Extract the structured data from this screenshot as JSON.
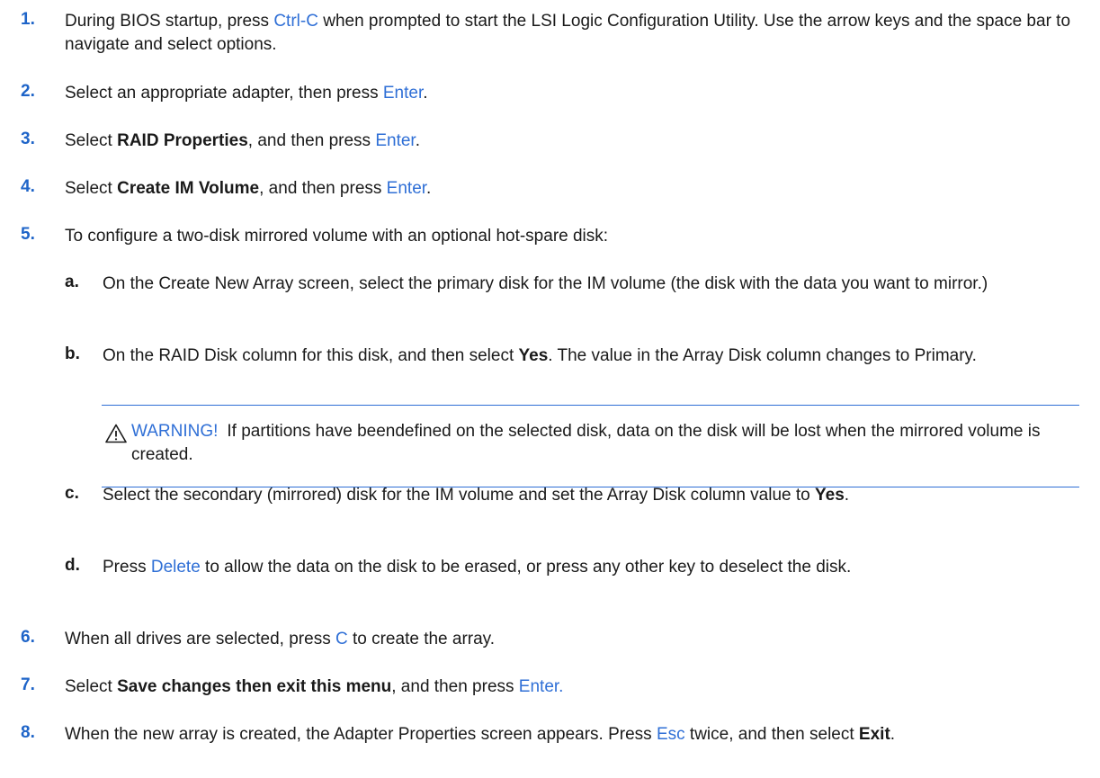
{
  "steps": [
    {
      "number": "1.",
      "part1": "During BIOS startup, press ",
      "key": "Ctrl-C",
      "part2": " when prompted to start the LSI Logic Configuration Utility. Use the arrow keys and the space bar to navigate and select options."
    },
    {
      "number": "2.",
      "part1": "Select an appropriate adapter, then press ",
      "key": "Enter",
      "part2": "."
    },
    {
      "number": "3.",
      "part1": "Select ",
      "bold": "RAID Properties",
      "part2": ", and then press ",
      "key": "Enter",
      "part3": "."
    },
    {
      "number": "4.",
      "part1": "Select ",
      "bold": "Create IM Volume",
      "part2": ", and then press ",
      "key": "Enter",
      "part3": "."
    },
    {
      "number": "5.",
      "text": "To configure a two-disk mirrored volume with an optional hot-spare disk:"
    },
    {
      "number": "6.",
      "part1": "When all drives are selected, press ",
      "key": "C",
      "part2": " to create the array."
    },
    {
      "number": "7.",
      "part1": "Select ",
      "bold": "Save changes then exit this menu",
      "part2": ", and then press ",
      "key": "Enter."
    },
    {
      "number": "8.",
      "part1": "When the new array is created, the Adapter Properties screen appears. Press ",
      "key": "Esc",
      "part2": " twice, and then select ",
      "bold": "Exit",
      "part3": "."
    }
  ],
  "substeps": [
    {
      "letter": "a.",
      "text": "On the Create New Array screen, select the primary disk for the IM volume (the disk with the data you want to mirror.)"
    },
    {
      "letter": "b.",
      "part1": "On the RAID Disk column for this disk, and then select ",
      "bold": "Yes",
      "part2": ". The value in the Array Disk column changes to Primary."
    },
    {
      "letter": "c.",
      "part1": "Select the secondary (mirrored) disk for the IM volume and set the Array Disk column value to ",
      "bold": "Yes",
      "part2": "."
    },
    {
      "letter": "d.",
      "part1": "Press ",
      "key": "Delete",
      "part2": " to allow the data on the disk to be erased, or press any other key to deselect the disk."
    }
  ],
  "warning": {
    "icon": "warning-triangle-icon",
    "label": "WARNING!",
    "text": "If partitions have beendefined on the selected disk, data on the disk will be lost when the mirrored volume is created."
  },
  "colors": {
    "accent": "#2f6fd6",
    "number": "#1e64c8",
    "text": "#1a1a1a"
  }
}
